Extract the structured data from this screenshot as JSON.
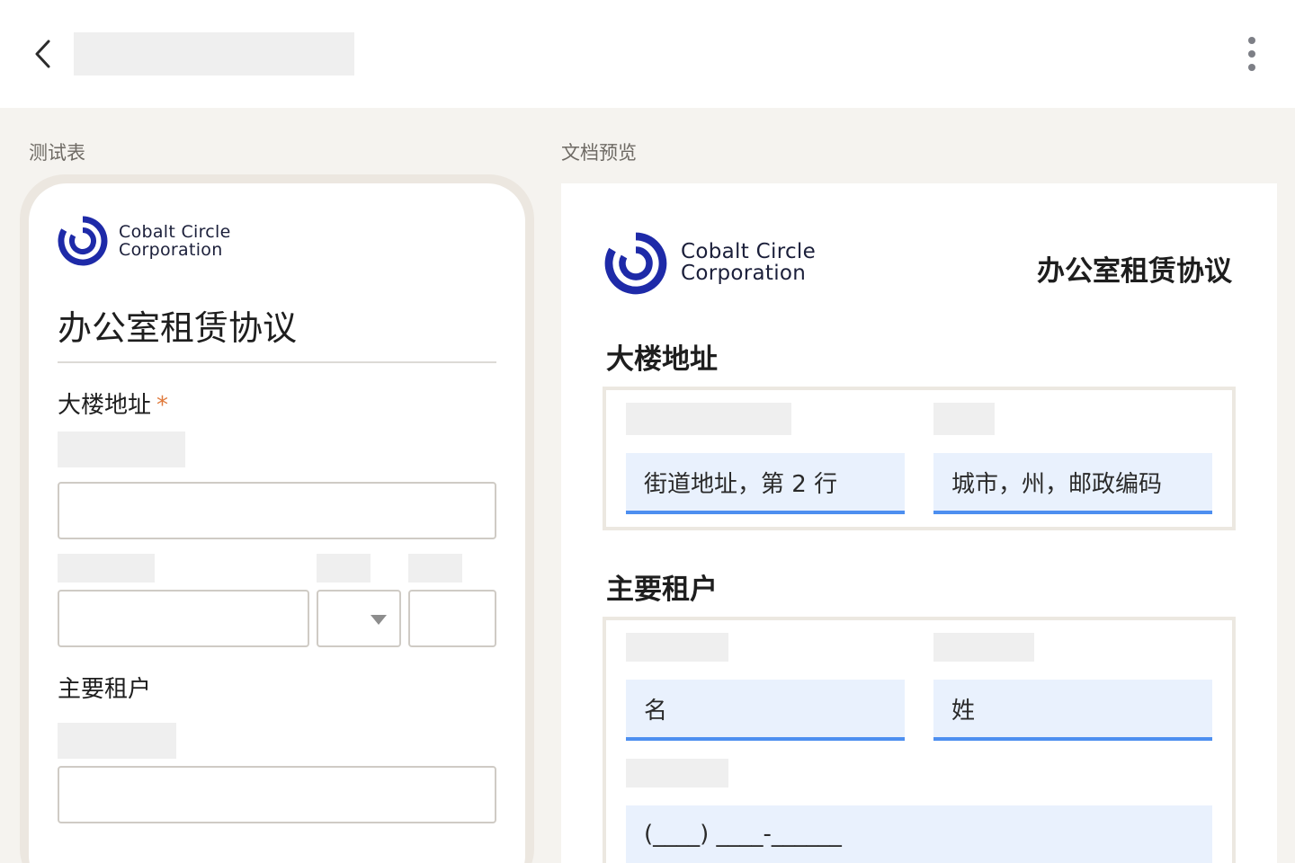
{
  "colors": {
    "accent": "#4d8ff0",
    "brand": "#1e2aa8",
    "required": "#e07a3c"
  },
  "topbar": {
    "back_icon": "chevron-left-icon",
    "more_icon": "more-vertical-icon"
  },
  "form_panel": {
    "label": "测试表",
    "brand": {
      "line1": "Cobalt Circle",
      "line2": "Corporation"
    },
    "title": "办公室租赁协议",
    "building_address": {
      "heading": "大楼地址",
      "required_mark": "*"
    },
    "primary_tenant": {
      "heading": "主要租户"
    }
  },
  "document_panel": {
    "label": "文档预览",
    "brand": {
      "line1": "Cobalt Circle",
      "line2": "Corporation"
    },
    "title": "办公室租赁协议",
    "building_address": {
      "heading": "大楼地址",
      "street_line2": "街道地址，第 2 行",
      "city_state_zip": "城市，州，邮政编码"
    },
    "primary_tenant": {
      "heading": "主要租户",
      "first_name": "名",
      "last_name": "姓",
      "phone": "(____) ____-______"
    }
  }
}
